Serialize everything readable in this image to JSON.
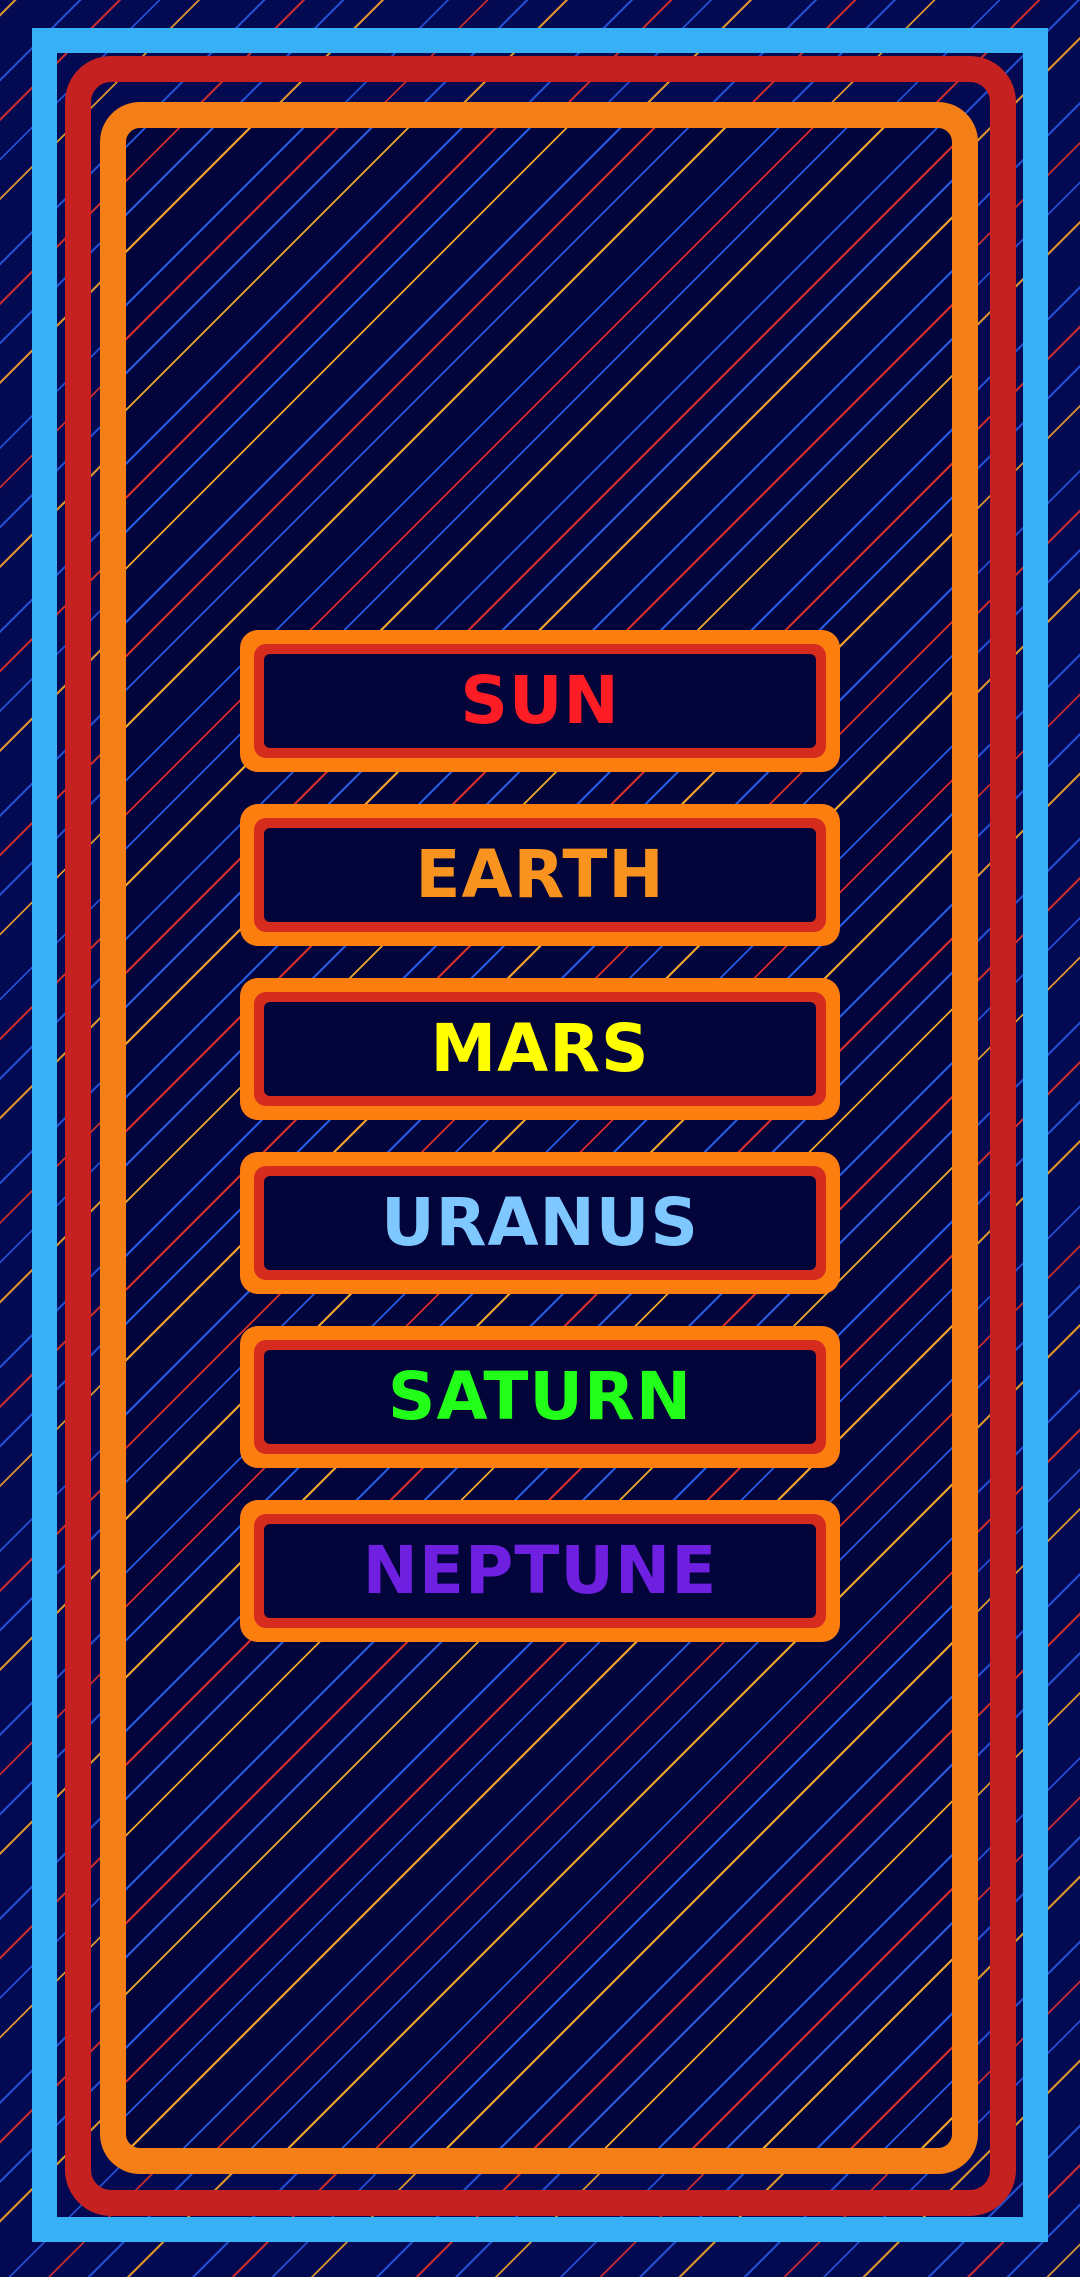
{
  "colors": {
    "background": "#040a52",
    "outer_frame": "#37b0f5",
    "middle_frame": "#c42120",
    "inner_frame": "#f47f16",
    "button_rim": "#fb7e0f",
    "button_inner_rim": "#d62c1f",
    "button_face": "#02043a"
  },
  "menu": {
    "items": [
      {
        "label": "SUN",
        "color": "#ff1d25"
      },
      {
        "label": "EARTH",
        "color": "#f7931e"
      },
      {
        "label": "MARS",
        "color": "#ffff00"
      },
      {
        "label": "URANUS",
        "color": "#7ec8ff"
      },
      {
        "label": "SATURN",
        "color": "#22ff18"
      },
      {
        "label": "NEPTUNE",
        "color": "#6e1fe0"
      }
    ]
  }
}
